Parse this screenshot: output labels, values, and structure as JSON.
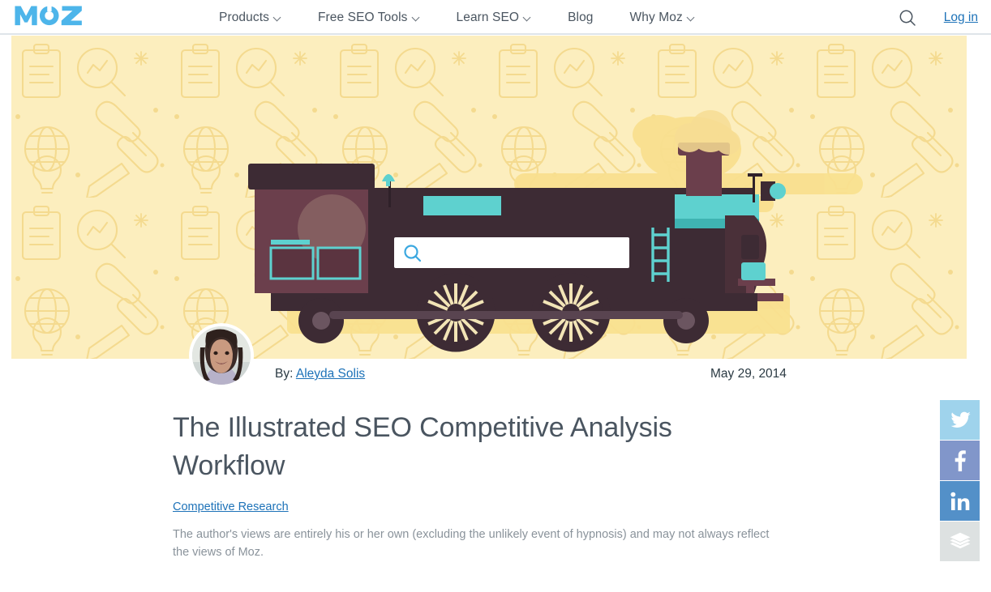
{
  "brand": {
    "logo_text": "MOZ",
    "logo_color": "#4db5ea"
  },
  "nav": {
    "items": [
      {
        "label": "Products",
        "icon": "chevron-down-icon",
        "has_dropdown": true
      },
      {
        "label": "Free SEO Tools",
        "icon": "chevron-down-icon",
        "has_dropdown": true
      },
      {
        "label": "Learn SEO",
        "icon": "chevron-down-icon",
        "has_dropdown": true
      },
      {
        "label": "Blog",
        "icon": null,
        "has_dropdown": false
      },
      {
        "label": "Why Moz",
        "icon": "chevron-down-icon",
        "has_dropdown": true
      }
    ],
    "search_icon": "search-icon",
    "login_label": "Log in",
    "login_color": "#1d72b8"
  },
  "hero": {
    "alt": "Illustrated steam locomotive with a search bar on its body over a pale yellow doodle background",
    "background_color": "#fceebe",
    "doodle_color": "#f6dd93",
    "train_body_color": "#3c2b33",
    "train_cab_color": "#6b3f4c",
    "train_accent_color": "#5ed1cf",
    "search_bar_icon": "search-icon"
  },
  "byline": {
    "avatar_name": "author-avatar",
    "by_label": "By:",
    "author_name": "Aleyda Solis",
    "date": "May 29, 2014"
  },
  "article": {
    "title": "The Illustrated SEO Competitive Analysis Workflow",
    "category": "Competitive Research",
    "disclaimer": "The author's views are entirely his or her own (excluding the unlikely event of hypnosis) and may not always reflect the views of Moz."
  },
  "share": {
    "buttons": [
      {
        "name": "twitter",
        "label": "Twitter",
        "icon": "twitter-icon",
        "color": "#9fd3ec"
      },
      {
        "name": "facebook",
        "label": "Facebook",
        "icon": "facebook-icon",
        "color": "#8196ca"
      },
      {
        "name": "linkedin",
        "label": "LinkedIn",
        "icon": "linkedin-icon",
        "color": "#5390c8"
      },
      {
        "name": "buffer",
        "label": "Buffer",
        "icon": "buffer-icon",
        "color": "#dde1e1"
      }
    ]
  }
}
